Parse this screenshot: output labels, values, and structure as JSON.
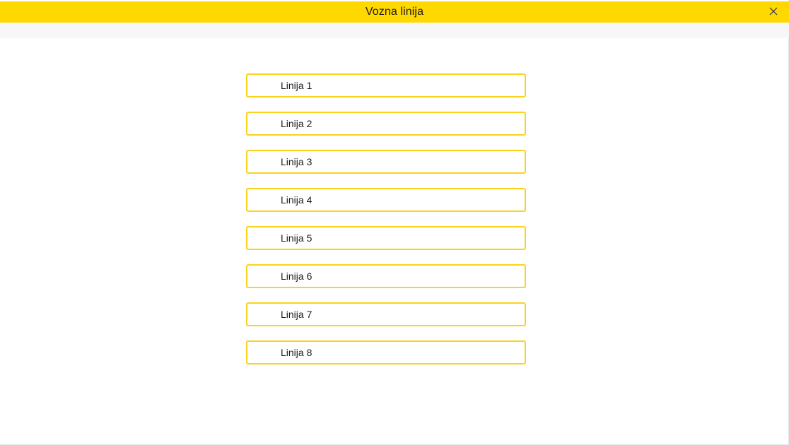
{
  "window": {
    "title": "Vozna linija"
  },
  "icons": {
    "close": "close-icon"
  },
  "colors": {
    "accent": "#ffd800",
    "item_border": "#fcd21c"
  },
  "lines": [
    {
      "label": "Linija 1"
    },
    {
      "label": "Linija 2"
    },
    {
      "label": "Linija 3"
    },
    {
      "label": "Linija 4"
    },
    {
      "label": "Linija 5"
    },
    {
      "label": "Linija 6"
    },
    {
      "label": "Linija 7"
    },
    {
      "label": "Linija 8"
    }
  ]
}
